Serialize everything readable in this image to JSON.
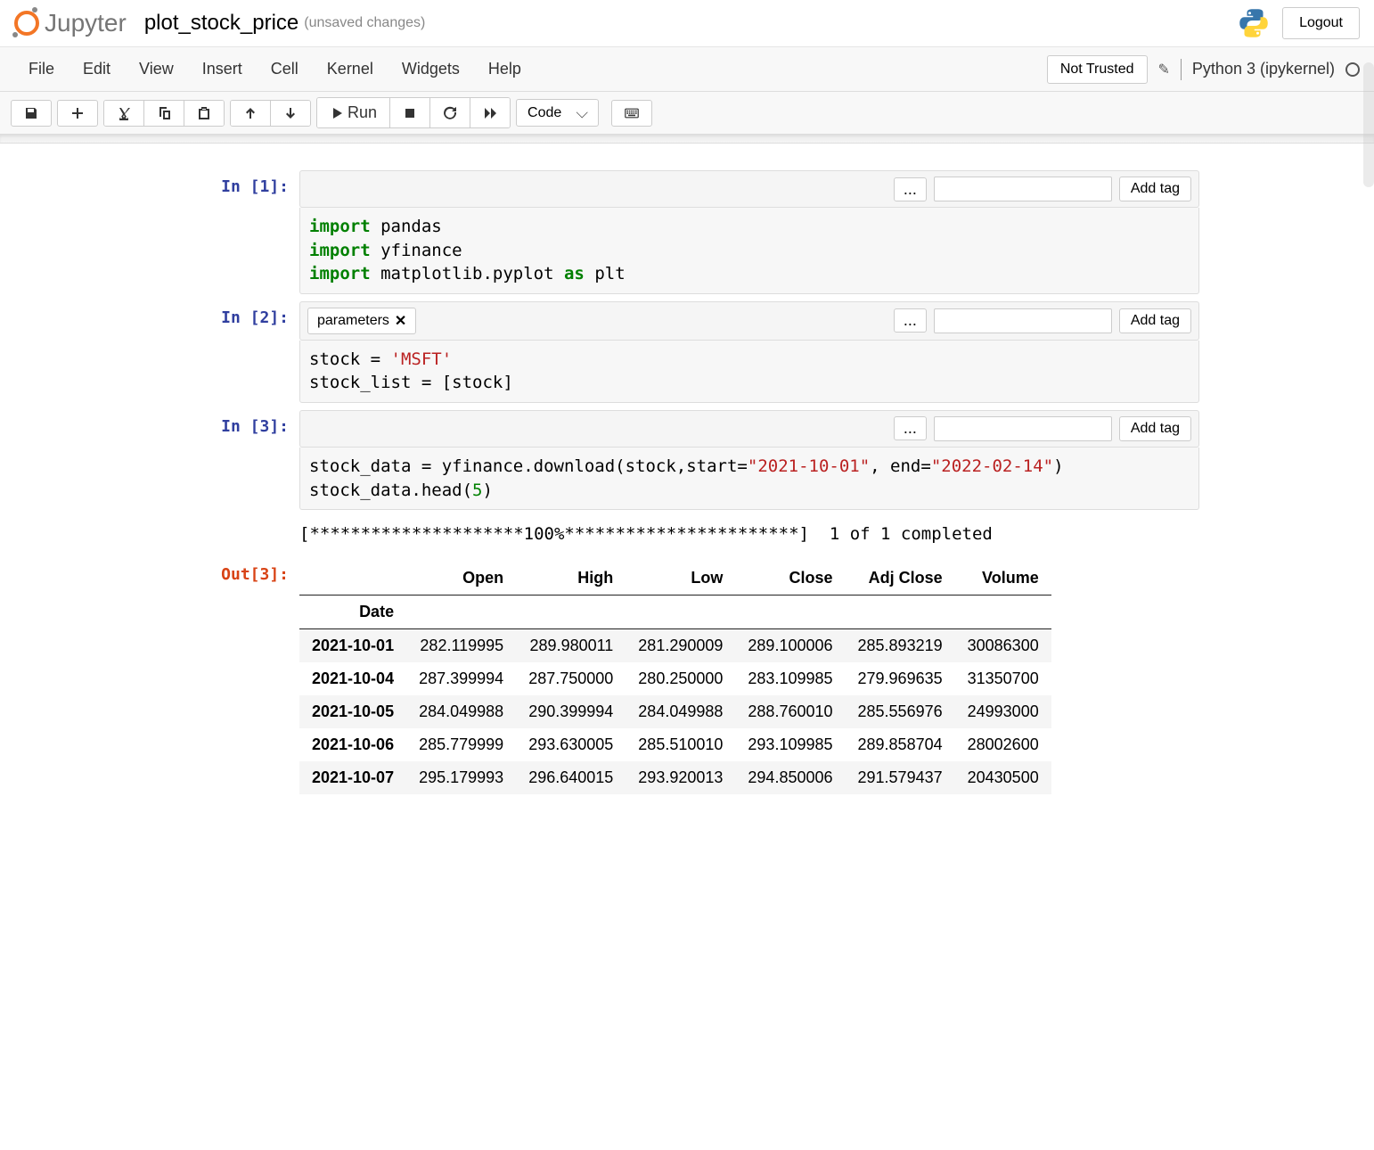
{
  "header": {
    "logo_text": "Jupyter",
    "notebook_name": "plot_stock_price",
    "status": "(unsaved changes)",
    "logout": "Logout"
  },
  "menubar": {
    "items": [
      "File",
      "Edit",
      "View",
      "Insert",
      "Cell",
      "Kernel",
      "Widgets",
      "Help"
    ],
    "trust": "Not Trusted",
    "kernel": "Python 3 (ipykernel)"
  },
  "toolbar": {
    "run_label": "Run",
    "cell_type": "Code"
  },
  "tag_ui": {
    "ellipsis": "...",
    "add_tag": "Add tag",
    "parameters_tag": "parameters"
  },
  "cells": [
    {
      "prompt": "In [1]:",
      "code_html": "<span class=\"kw\">import</span> pandas\n<span class=\"kw\">import</span> yfinance\n<span class=\"kw\">import</span> matplotlib.pyplot <span class=\"kw\">as</span> plt"
    },
    {
      "prompt": "In [2]:",
      "code_html": "stock = <span class=\"str\">'MSFT'</span>\nstock_list = [stock]"
    },
    {
      "prompt": "In [3]:",
      "code_html": "stock_data = yfinance.download(stock,start=<span class=\"str\">\"2021-10-01\"</span>, end=<span class=\"str\">\"2022-02-14\"</span>)\nstock_data.head(<span class=\"num\">5</span>)"
    }
  ],
  "output3": {
    "progress": "[*********************100%***********************]  1 of 1 completed",
    "prompt": "Out[3]:",
    "columns": [
      "Open",
      "High",
      "Low",
      "Close",
      "Adj Close",
      "Volume"
    ],
    "index_name": "Date",
    "rows": [
      {
        "date": "2021-10-01",
        "vals": [
          "282.119995",
          "289.980011",
          "281.290009",
          "289.100006",
          "285.893219",
          "30086300"
        ]
      },
      {
        "date": "2021-10-04",
        "vals": [
          "287.399994",
          "287.750000",
          "280.250000",
          "283.109985",
          "279.969635",
          "31350700"
        ]
      },
      {
        "date": "2021-10-05",
        "vals": [
          "284.049988",
          "290.399994",
          "284.049988",
          "288.760010",
          "285.556976",
          "24993000"
        ]
      },
      {
        "date": "2021-10-06",
        "vals": [
          "285.779999",
          "293.630005",
          "285.510010",
          "293.109985",
          "289.858704",
          "28002600"
        ]
      },
      {
        "date": "2021-10-07",
        "vals": [
          "295.179993",
          "296.640015",
          "293.920013",
          "294.850006",
          "291.579437",
          "20430500"
        ]
      }
    ]
  }
}
